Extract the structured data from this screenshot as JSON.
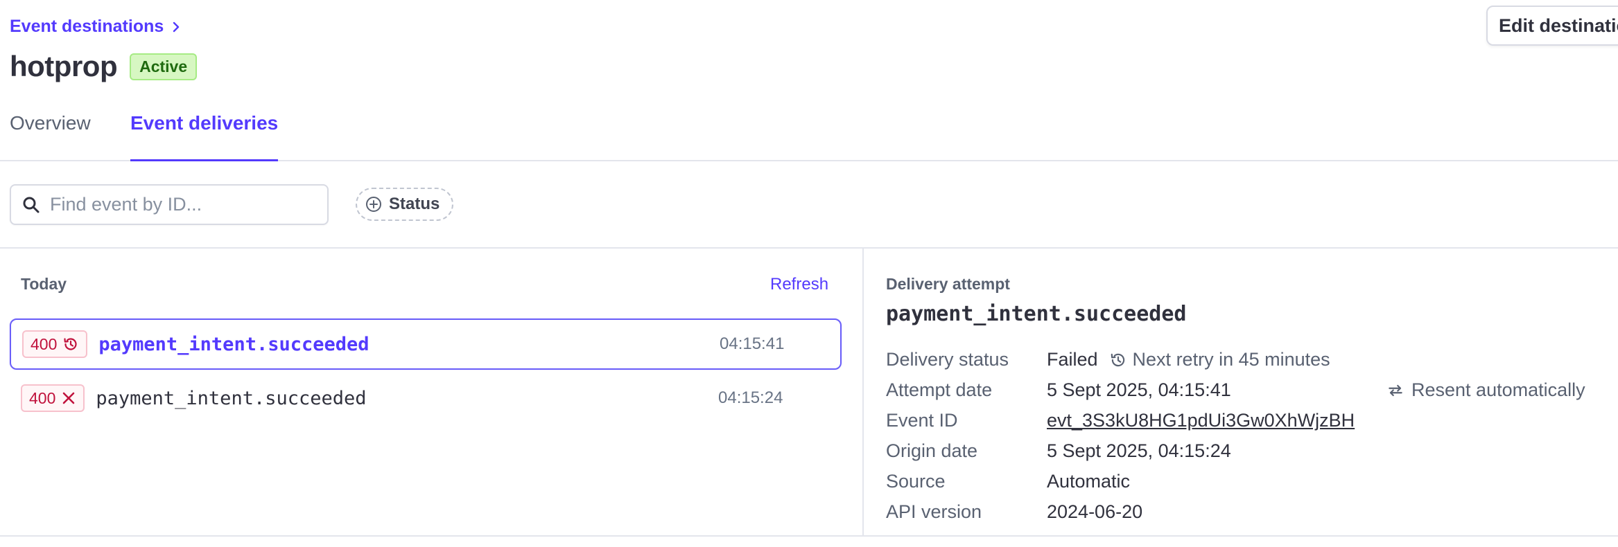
{
  "header": {
    "breadcrumb": "Event destinations",
    "title": "hotprop",
    "status_badge": "Active",
    "edit_button": "Edit destination"
  },
  "tabs": [
    {
      "label": "Overview",
      "active": false
    },
    {
      "label": "Event deliveries",
      "active": true
    }
  ],
  "filters": {
    "search_placeholder": "Find event by ID...",
    "status_chip": "Status"
  },
  "list": {
    "group_label": "Today",
    "refresh_label": "Refresh",
    "rows": [
      {
        "code": "400",
        "icon": "history-icon",
        "event": "payment_intent.succeeded",
        "time": "04:15:41",
        "selected": true
      },
      {
        "code": "400",
        "icon": "x-icon",
        "event": "payment_intent.succeeded",
        "time": "04:15:24",
        "selected": false
      }
    ]
  },
  "detail": {
    "heading": "Delivery attempt",
    "event": "payment_intent.succeeded",
    "fields": {
      "delivery_status": {
        "label": "Delivery status",
        "value": "Failed",
        "retry": "Next retry in 45 minutes"
      },
      "attempt_date": {
        "label": "Attempt date",
        "value": "5 Sept 2025, 04:15:41"
      },
      "resent": "Resent automatically",
      "event_id": {
        "label": "Event ID",
        "value": "evt_3S3kU8HG1pdUi3Gw0XhWjzBH"
      },
      "origin_date": {
        "label": "Origin date",
        "value": "5 Sept 2025, 04:15:24"
      },
      "source": {
        "label": "Source",
        "value": "Automatic"
      },
      "api_version": {
        "label": "API version",
        "value": "2024-06-20"
      }
    }
  },
  "colors": {
    "accent": "#533afd",
    "error": "#c0123c",
    "success_bg": "#d7f7c2",
    "success_text": "#1f6a0f"
  }
}
